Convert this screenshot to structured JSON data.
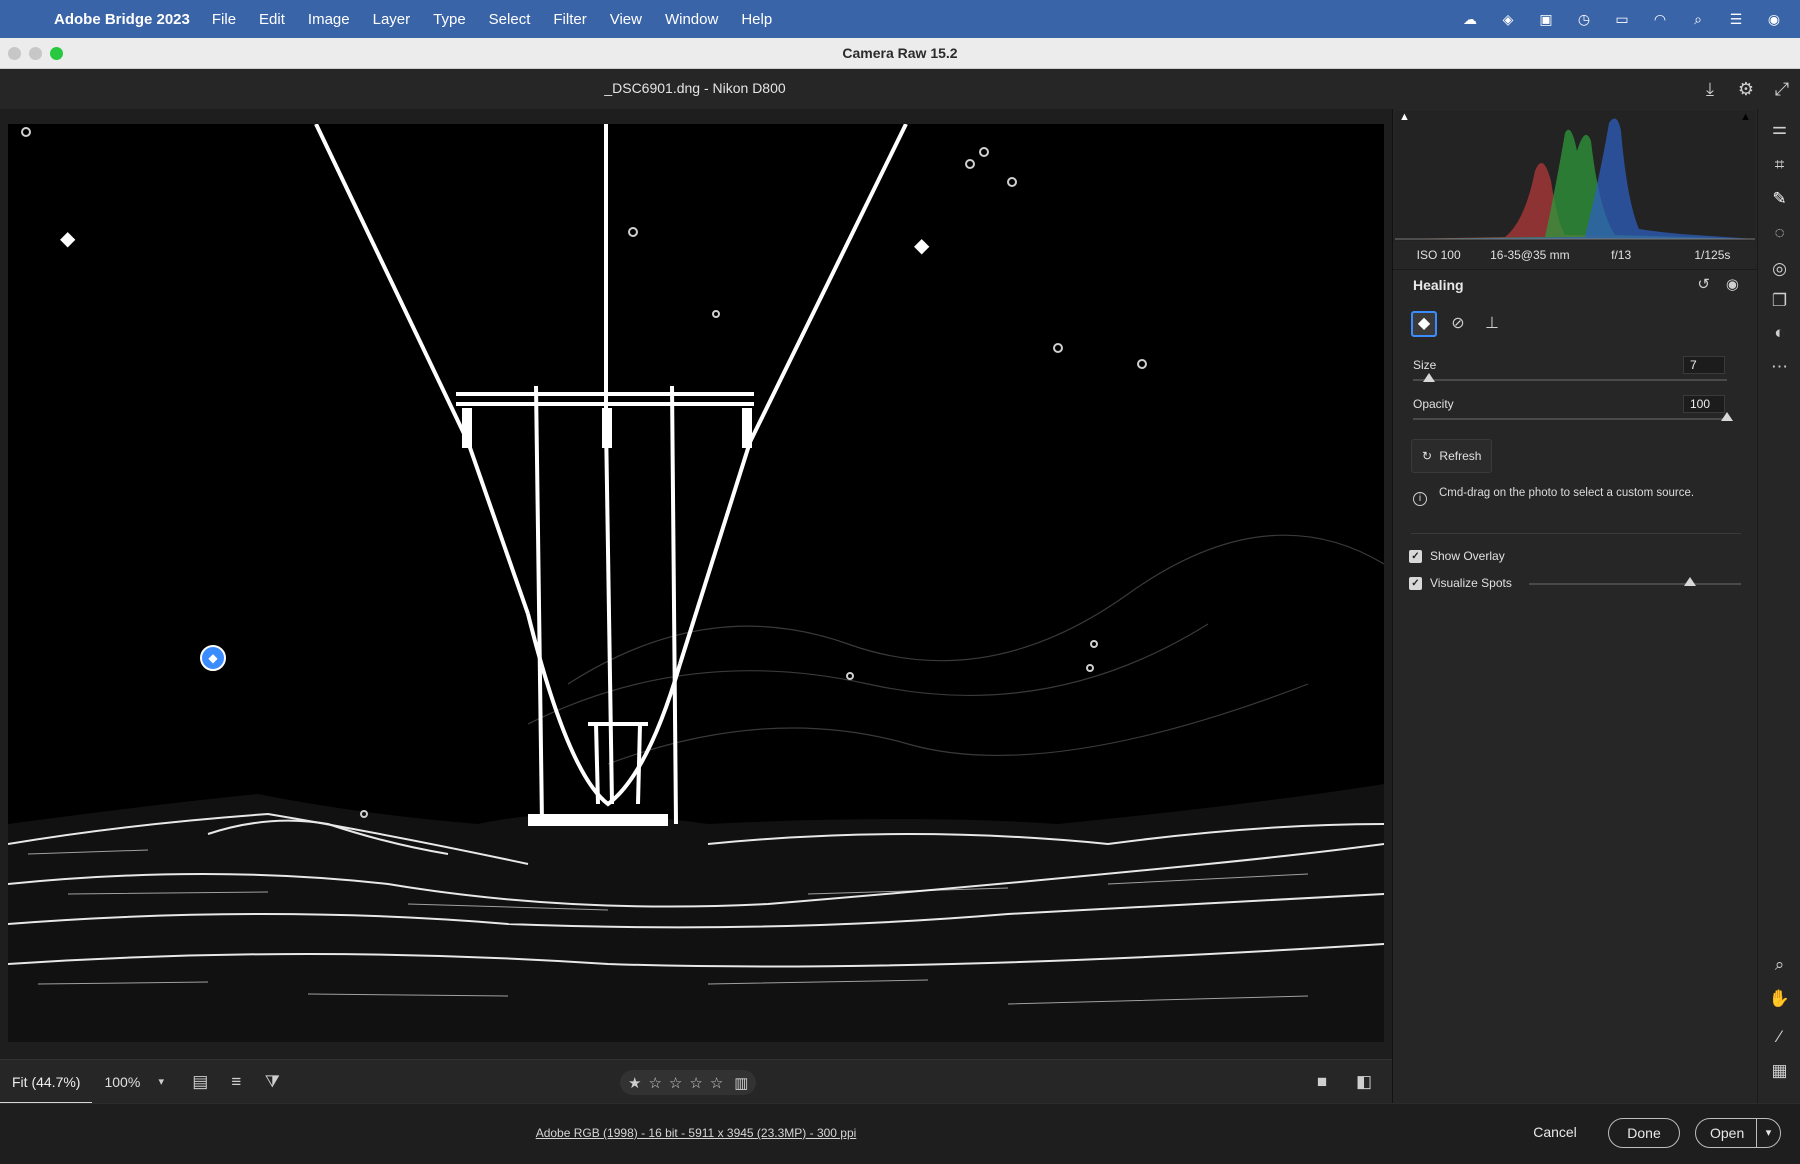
{
  "menubar": {
    "app_name": "Adobe Bridge 2023",
    "items": [
      "File",
      "Edit",
      "Image",
      "Layer",
      "Type",
      "Select",
      "Filter",
      "View",
      "Window",
      "Help"
    ],
    "status_icons": [
      "creative-cloud-icon",
      "location-icon",
      "screen-icon",
      "time-machine-icon",
      "battery-icon",
      "wifi-icon",
      "search-icon",
      "control-center-icon",
      "siri-icon"
    ]
  },
  "window": {
    "title": "Camera Raw 15.2"
  },
  "file": {
    "name": "_DSC6901.dng  -  Nikon D800"
  },
  "bottombar": {
    "zoom_fit": "Fit (44.7%)",
    "zoom_value": "100%",
    "rating_stars": 5
  },
  "footer": {
    "info": "Adobe RGB (1998) - 16 bit - 5911 x 3945 (23.3MP) - 300 ppi",
    "cancel": "Cancel",
    "done": "Done",
    "open": "Open"
  },
  "exif": {
    "iso": "ISO 100",
    "lens": "16-35@35 mm",
    "aperture": "f/13",
    "shutter": "1/125s"
  },
  "healing": {
    "title": "Healing",
    "size_label": "Size",
    "size_value": "7",
    "size_level": 0.05,
    "opacity_label": "Opacity",
    "opacity_value": "100",
    "opacity_level": 1.0,
    "refresh_label": "Refresh",
    "hint": "Cmd-drag on the photo to select a custom source.",
    "show_overlay_label": "Show Overlay",
    "show_overlay_checked": true,
    "visualize_spots_label": "Visualize Spots",
    "visualize_spots_checked": true,
    "visualize_level": 0.76
  },
  "colors": {
    "menubar": "#3a64a8",
    "accent": "#3b8cff",
    "panel": "#262626"
  }
}
